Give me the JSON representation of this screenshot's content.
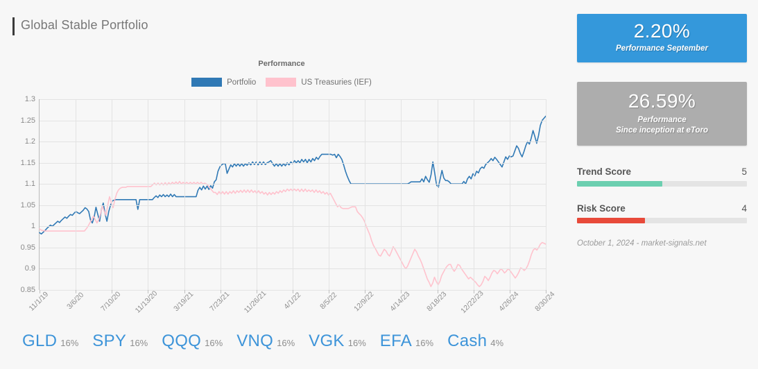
{
  "header": {
    "title": "Global Stable Portfolio",
    "accent_bar_color": "#3a3a3a"
  },
  "chart_panel": {
    "title": "Performance",
    "legend": [
      {
        "label": "Portfolio",
        "color": "#3079b5"
      },
      {
        "label": "US Treasuries (IEF)",
        "color": "#ffc2cd"
      }
    ]
  },
  "allocations": [
    {
      "ticker": "GLD",
      "percent": "16%"
    },
    {
      "ticker": "SPY",
      "percent": "16%"
    },
    {
      "ticker": "QQQ",
      "percent": "16%"
    },
    {
      "ticker": "VNQ",
      "percent": "16%"
    },
    {
      "ticker": "VGK",
      "percent": "16%"
    },
    {
      "ticker": "EFA",
      "percent": "16%"
    },
    {
      "ticker": "Cash",
      "percent": "4%"
    }
  ],
  "stats": {
    "primary": {
      "value": "2.20%",
      "label": "Performance September",
      "color": "#3498db"
    },
    "secondary": {
      "value": "26.59%",
      "label_line1": "Performance",
      "label_line2": "Since inception at eToro",
      "color": "#adadad"
    }
  },
  "scores": [
    {
      "name": "Trend Score",
      "value": "5",
      "fill_percent": 50,
      "color": "#6ccfb0"
    },
    {
      "name": "Risk Score",
      "value": "4",
      "fill_percent": 40,
      "color": "#e84a3a"
    }
  ],
  "footnote": "October 1, 2024 - market-signals.net",
  "chart_data": {
    "type": "line",
    "title": "Performance",
    "xlabel": "",
    "ylabel": "",
    "ylim": [
      0.85,
      1.3
    ],
    "yticks": [
      0.85,
      0.9,
      0.95,
      1.0,
      1.05,
      1.1,
      1.15,
      1.2,
      1.25,
      1.3
    ],
    "ytick_labels": [
      "0.85",
      "0.9",
      "0.95",
      "1",
      "1.05",
      "1.1",
      "1.15",
      "1.2",
      "1.25",
      "1.3"
    ],
    "grid": true,
    "legend_position": "top-center",
    "xtick_labels": [
      "11/1/19",
      "3/6/20",
      "7/10/20",
      "11/13/20",
      "3/19/21",
      "7/23/21",
      "11/26/21",
      "4/1/22",
      "8/5/22",
      "12/9/22",
      "4/14/23",
      "8/18/23",
      "12/22/23",
      "4/26/24",
      "8/30/24"
    ],
    "x_count": 261,
    "series": [
      {
        "name": "Portfolio",
        "color": "#3079b5",
        "values": [
          0.985,
          0.982,
          0.986,
          0.99,
          0.995,
          0.999,
          1.003,
          1.0,
          1.004,
          1.008,
          1.012,
          1.009,
          1.014,
          1.018,
          1.022,
          1.019,
          1.024,
          1.028,
          1.026,
          1.031,
          1.035,
          1.032,
          1.03,
          1.034,
          1.038,
          1.044,
          1.041,
          1.035,
          1.015,
          1.008,
          1.022,
          1.045,
          1.028,
          1.012,
          1.04,
          1.055,
          1.03,
          1.012,
          1.035,
          1.05,
          1.06,
          1.062,
          1.063,
          1.063,
          1.063,
          1.063,
          1.063,
          1.063,
          1.063,
          1.063,
          1.063,
          1.063,
          1.063,
          1.063,
          1.04,
          1.063,
          1.063,
          1.063,
          1.063,
          1.063,
          1.063,
          1.063,
          1.063,
          1.068,
          1.072,
          1.068,
          1.074,
          1.07,
          1.075,
          1.07,
          1.074,
          1.07,
          1.076,
          1.07,
          1.075,
          1.07,
          1.07,
          1.07,
          1.07,
          1.07,
          1.07,
          1.07,
          1.07,
          1.07,
          1.07,
          1.07,
          1.07,
          1.085,
          1.092,
          1.086,
          1.095,
          1.088,
          1.095,
          1.087,
          1.096,
          1.09,
          1.105,
          1.11,
          1.13,
          1.14,
          1.145,
          1.148,
          1.148,
          1.125,
          1.135,
          1.145,
          1.14,
          1.148,
          1.142,
          1.148,
          1.142,
          1.148,
          1.142,
          1.148,
          1.144,
          1.15,
          1.145,
          1.152,
          1.146,
          1.152,
          1.145,
          1.152,
          1.146,
          1.152,
          1.146,
          1.15,
          1.152,
          1.155,
          1.148,
          1.142,
          1.148,
          1.142,
          1.148,
          1.142,
          1.148,
          1.143,
          1.15,
          1.145,
          1.152,
          1.148,
          1.155,
          1.15,
          1.155,
          1.15,
          1.158,
          1.152,
          1.158,
          1.15,
          1.158,
          1.152,
          1.16,
          1.155,
          1.163,
          1.158,
          1.165,
          1.17,
          1.17,
          1.17,
          1.17,
          1.17,
          1.17,
          1.168,
          1.17,
          1.162,
          1.17,
          1.165,
          1.158,
          1.145,
          1.13,
          1.118,
          1.108,
          1.1,
          1.1,
          1.1,
          1.1,
          1.1,
          1.1,
          1.1,
          1.1,
          1.1,
          1.1,
          1.1,
          1.1,
          1.1,
          1.1,
          1.1,
          1.1,
          1.1,
          1.1,
          1.1,
          1.1,
          1.1,
          1.1,
          1.1,
          1.1,
          1.1,
          1.1,
          1.1,
          1.1,
          1.1,
          1.1,
          1.1,
          1.1,
          1.102,
          1.105,
          1.105,
          1.105,
          1.105,
          1.105,
          1.105,
          1.112,
          1.105,
          1.118,
          1.11,
          1.104,
          1.122,
          1.152,
          1.126,
          1.098,
          1.092,
          1.112,
          1.132,
          1.114,
          1.108,
          1.108,
          1.105,
          1.1,
          1.1,
          1.1,
          1.1,
          1.1,
          1.1,
          1.1,
          1.106,
          1.1,
          1.112,
          1.118,
          1.112,
          1.124,
          1.119,
          1.13,
          1.126,
          1.136,
          1.14,
          1.137,
          1.146,
          1.15,
          1.154,
          1.16,
          1.155,
          1.163,
          1.158,
          1.152,
          1.146,
          1.14,
          1.152,
          1.164,
          1.158,
          1.166,
          1.164,
          1.166,
          1.178,
          1.19,
          1.184,
          1.172,
          1.164,
          1.176,
          1.19,
          1.2,
          1.194,
          1.208,
          1.226,
          1.212,
          1.196,
          1.214,
          1.238,
          1.25,
          1.255,
          1.26
        ]
      },
      {
        "name": "US Treasuries (IEF)",
        "color": "#ffc2cd",
        "values": [
          0.994,
          0.991,
          0.99,
          0.989,
          0.989,
          0.989,
          0.989,
          0.989,
          0.989,
          0.989,
          0.989,
          0.989,
          0.989,
          0.989,
          0.989,
          0.989,
          0.989,
          0.989,
          0.989,
          0.989,
          0.989,
          0.989,
          0.989,
          0.989,
          0.989,
          0.989,
          0.994,
          1.0,
          1.008,
          1.016,
          1.024,
          1.016,
          1.008,
          1.016,
          1.03,
          1.048,
          1.036,
          1.026,
          1.05,
          1.07,
          1.056,
          1.044,
          1.064,
          1.078,
          1.086,
          1.09,
          1.092,
          1.092,
          1.092,
          1.094,
          1.094,
          1.094,
          1.094,
          1.094,
          1.094,
          1.094,
          1.094,
          1.094,
          1.094,
          1.094,
          1.094,
          1.094,
          1.094,
          1.098,
          1.102,
          1.098,
          1.102,
          1.098,
          1.102,
          1.098,
          1.103,
          1.098,
          1.103,
          1.099,
          1.104,
          1.1,
          1.105,
          1.1,
          1.106,
          1.1,
          1.104,
          1.1,
          1.104,
          1.1,
          1.104,
          1.1,
          1.104,
          1.1,
          1.104,
          1.1,
          1.104,
          1.1,
          1.102,
          1.1,
          1.096,
          1.09,
          1.085,
          1.08,
          1.08,
          1.075,
          1.082,
          1.076,
          1.082,
          1.076,
          1.082,
          1.076,
          1.082,
          1.078,
          1.084,
          1.078,
          1.084,
          1.08,
          1.085,
          1.08,
          1.086,
          1.08,
          1.086,
          1.08,
          1.086,
          1.08,
          1.084,
          1.078,
          1.084,
          1.078,
          1.082,
          1.076,
          1.08,
          1.074,
          1.08,
          1.075,
          1.08,
          1.076,
          1.082,
          1.078,
          1.084,
          1.08,
          1.086,
          1.082,
          1.088,
          1.084,
          1.088,
          1.084,
          1.088,
          1.084,
          1.088,
          1.082,
          1.088,
          1.082,
          1.088,
          1.082,
          1.086,
          1.082,
          1.086,
          1.08,
          1.086,
          1.08,
          1.084,
          1.078,
          1.082,
          1.076,
          1.08,
          1.074,
          1.078,
          1.07,
          1.062,
          1.054,
          1.046,
          1.05,
          1.044,
          1.042,
          1.042,
          1.042,
          1.042,
          1.044,
          1.046,
          1.046,
          1.046,
          1.035,
          1.03,
          1.026,
          1.02,
          1.012,
          1.0,
          0.99,
          0.98,
          0.966,
          0.955,
          0.948,
          0.94,
          0.932,
          0.93,
          0.938,
          0.946,
          0.942,
          0.934,
          0.93,
          0.94,
          0.952,
          0.946,
          0.938,
          0.93,
          0.922,
          0.914,
          0.906,
          0.9,
          0.906,
          0.916,
          0.926,
          0.936,
          0.946,
          0.94,
          0.93,
          0.922,
          0.912,
          0.9,
          0.888,
          0.876,
          0.868,
          0.858,
          0.866,
          0.88,
          0.87,
          0.862,
          0.87,
          0.884,
          0.892,
          0.9,
          0.906,
          0.91,
          0.91,
          0.9,
          0.894,
          0.9,
          0.91,
          0.908,
          0.9,
          0.894,
          0.888,
          0.882,
          0.876,
          0.88,
          0.876,
          0.872,
          0.868,
          0.862,
          0.858,
          0.862,
          0.87,
          0.882,
          0.878,
          0.872,
          0.88,
          0.89,
          0.896,
          0.894,
          0.888,
          0.894,
          0.9,
          0.896,
          0.89,
          0.894,
          0.9,
          0.896,
          0.89,
          0.884,
          0.878,
          0.884,
          0.892,
          0.902,
          0.9,
          0.896,
          0.9,
          0.908,
          0.92,
          0.934,
          0.944,
          0.948,
          0.944,
          0.95,
          0.958,
          0.962,
          0.96,
          0.958
        ]
      }
    ]
  }
}
